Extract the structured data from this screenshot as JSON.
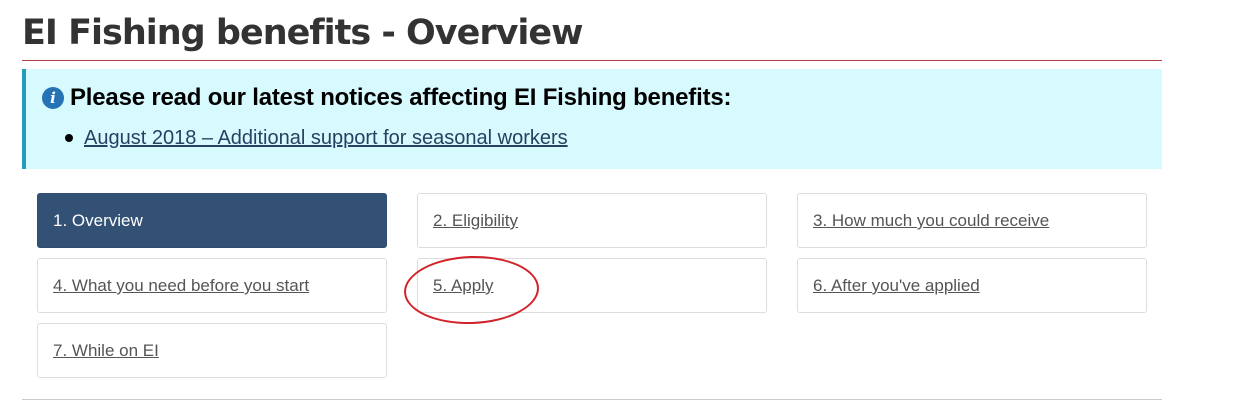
{
  "page": {
    "title": "EI Fishing benefits - Overview"
  },
  "notice": {
    "icon": "info-icon",
    "heading": "Please read our latest notices affecting EI Fishing benefits:",
    "items": [
      {
        "label": "August 2018 – Additional support for seasonal workers"
      }
    ]
  },
  "steps": [
    {
      "label": "1. Overview",
      "active": true
    },
    {
      "label": "2. Eligibility"
    },
    {
      "label": "3. How much you could receive"
    },
    {
      "label": "4. What you need before you start"
    },
    {
      "label": "5. Apply"
    },
    {
      "label": "6. After you've applied"
    },
    {
      "label": "7. While on EI"
    }
  ],
  "colors": {
    "active_step": "#335075",
    "notice_background": "#d7faff",
    "notice_border": "#269abc",
    "title_rule": "#af3c43",
    "annotation": "#d3232a"
  }
}
